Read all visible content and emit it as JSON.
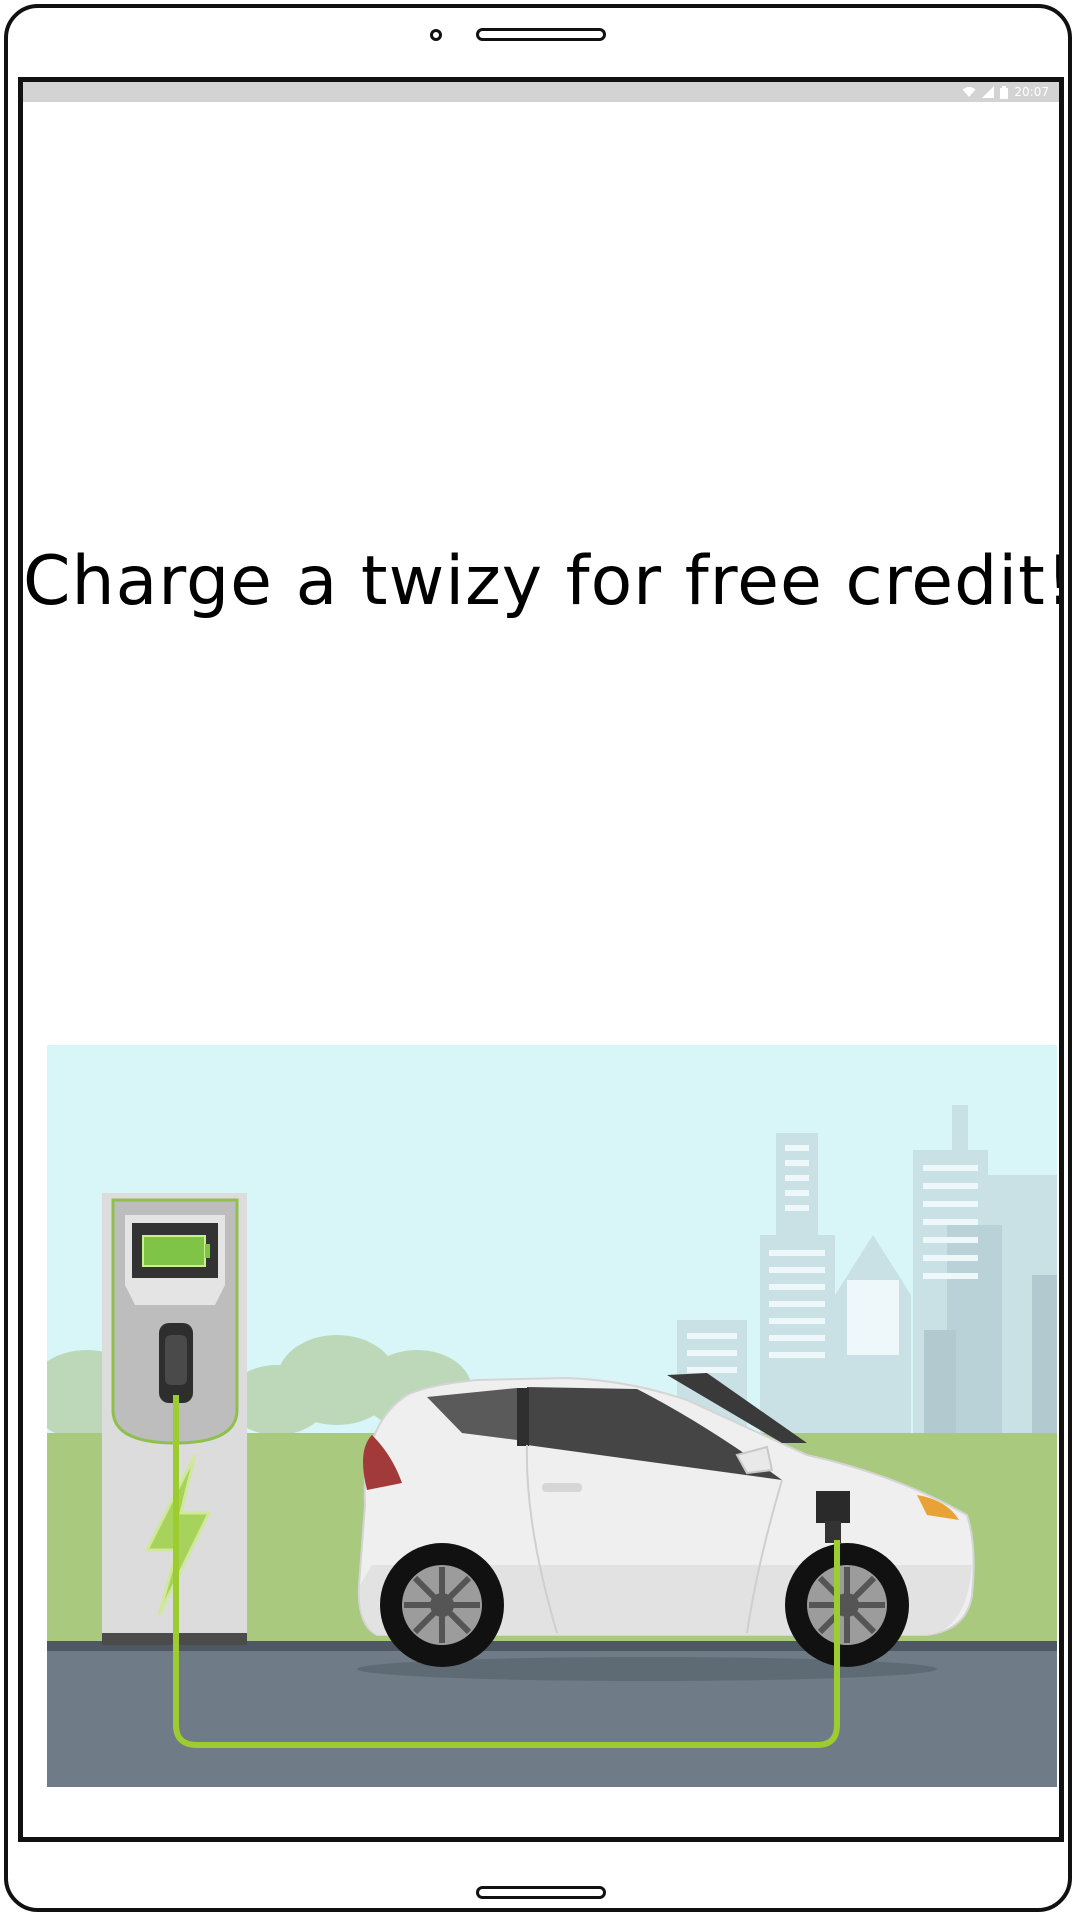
{
  "status_bar": {
    "time": "20:07",
    "icons": [
      "wifi-icon",
      "signal-icon",
      "battery-icon"
    ]
  },
  "main": {
    "headline": "Charge a twizy for free credit!",
    "illustration_name": "ev-charging-illustration"
  },
  "colors": {
    "status_bar": "#d3d3d3",
    "sky": "#d8f5f8",
    "grass": "#a8c97e",
    "road": "#6f7c88",
    "cable": "#9ccc2f",
    "car_body": "#efefef"
  }
}
